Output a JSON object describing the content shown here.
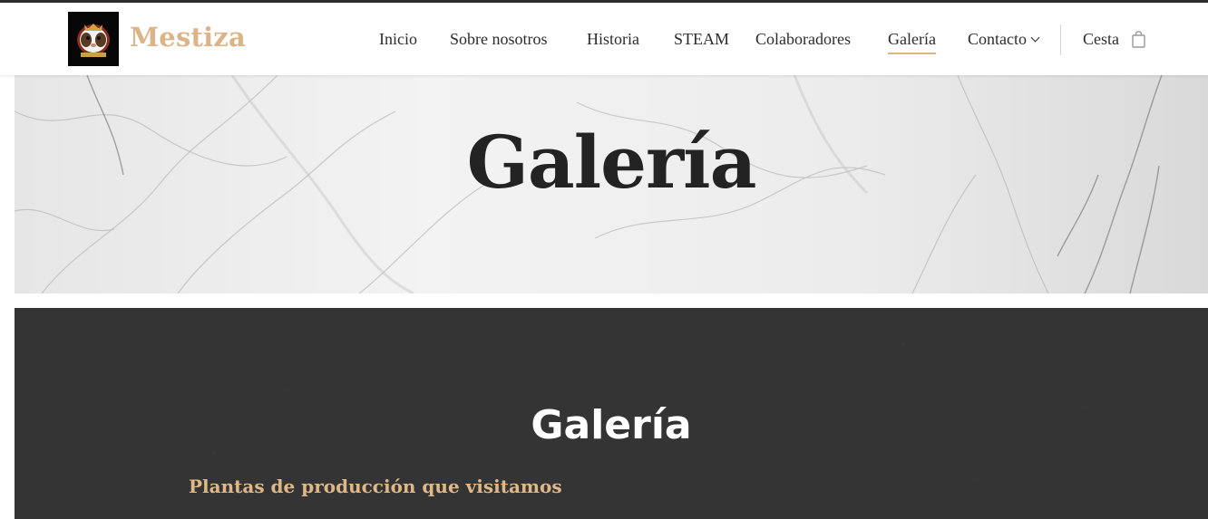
{
  "brand": {
    "name": "Mestiza",
    "logo_icon": "guinea-pig-crest-logo"
  },
  "nav": {
    "items": [
      {
        "label": "Inicio"
      },
      {
        "label": "Sobre nosotros"
      },
      {
        "label": "Historia"
      },
      {
        "label": "STEAM"
      },
      {
        "label": "Colaboradores"
      },
      {
        "label": "Galería",
        "active": true
      },
      {
        "label": "Contacto",
        "has_dropdown": true
      }
    ],
    "cart_label": "Cesta",
    "cart_icon": "shopping-bag-icon"
  },
  "hero": {
    "title": "Galería",
    "background": "white-marble"
  },
  "section": {
    "title": "Galería",
    "subtitle": "Plantas de producción que visitamos",
    "background": "dark-charcoal-texture"
  },
  "colors": {
    "accent": "#dcb487",
    "text": "#2c2c2c",
    "dark_bg": "#343434",
    "white": "#ffffff"
  }
}
